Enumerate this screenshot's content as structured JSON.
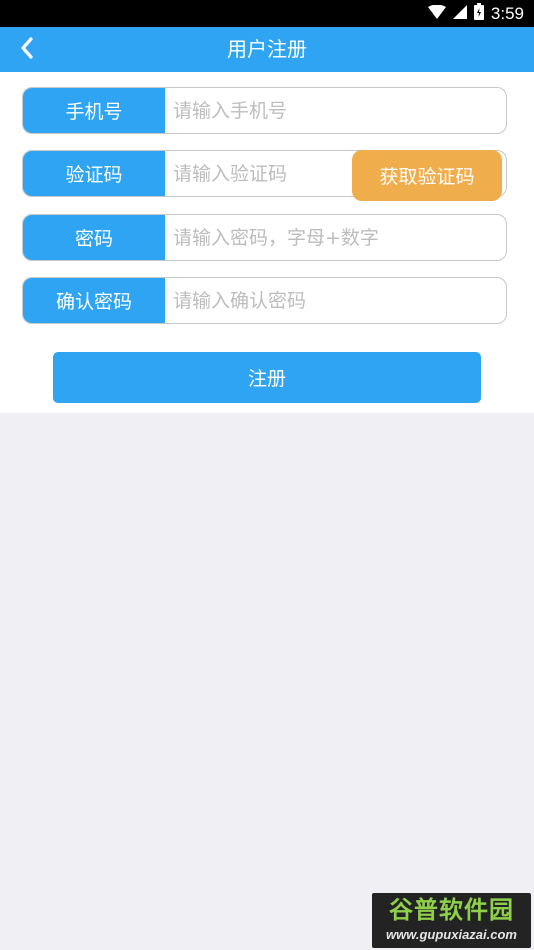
{
  "status_bar": {
    "time": "3:59",
    "icons": [
      "wifi-icon",
      "signal-icon",
      "battery-icon"
    ]
  },
  "header": {
    "title": "用户注册",
    "back_icon": "chevron-left-icon"
  },
  "form": {
    "phone": {
      "label": "手机号",
      "placeholder": "请输入手机号",
      "value": ""
    },
    "code": {
      "label": "验证码",
      "placeholder": "请输入验证码",
      "value": "",
      "button_label": "获取验证码"
    },
    "password": {
      "label": "密码",
      "placeholder": "请输入密码，字母+数字",
      "value": ""
    },
    "confirm_password": {
      "label": "确认密码",
      "placeholder": "请输入确认密码",
      "value": ""
    }
  },
  "register_button": {
    "label": "注册"
  },
  "watermark": {
    "logo_text": "谷普软件园",
    "url": "www.gupuxiazai.com"
  },
  "colors": {
    "primary": "#2ea4f3",
    "accent": "#efad4c",
    "background": "#efeff4",
    "status_bar": "#000000"
  }
}
